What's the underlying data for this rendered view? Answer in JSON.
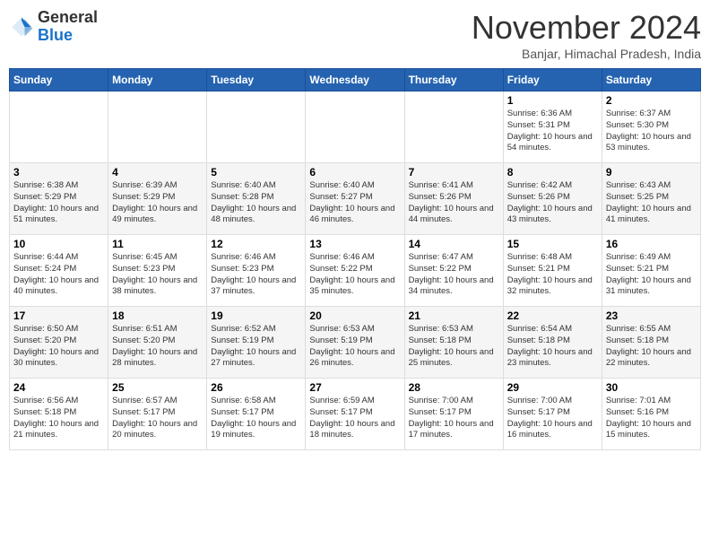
{
  "header": {
    "logo_general": "General",
    "logo_blue": "Blue",
    "month_title": "November 2024",
    "location": "Banjar, Himachal Pradesh, India"
  },
  "days_of_week": [
    "Sunday",
    "Monday",
    "Tuesday",
    "Wednesday",
    "Thursday",
    "Friday",
    "Saturday"
  ],
  "weeks": [
    [
      {
        "day": "",
        "sunrise": "",
        "sunset": "",
        "daylight": ""
      },
      {
        "day": "",
        "sunrise": "",
        "sunset": "",
        "daylight": ""
      },
      {
        "day": "",
        "sunrise": "",
        "sunset": "",
        "daylight": ""
      },
      {
        "day": "",
        "sunrise": "",
        "sunset": "",
        "daylight": ""
      },
      {
        "day": "",
        "sunrise": "",
        "sunset": "",
        "daylight": ""
      },
      {
        "day": "1",
        "sunrise": "Sunrise: 6:36 AM",
        "sunset": "Sunset: 5:31 PM",
        "daylight": "Daylight: 10 hours and 54 minutes."
      },
      {
        "day": "2",
        "sunrise": "Sunrise: 6:37 AM",
        "sunset": "Sunset: 5:30 PM",
        "daylight": "Daylight: 10 hours and 53 minutes."
      }
    ],
    [
      {
        "day": "3",
        "sunrise": "Sunrise: 6:38 AM",
        "sunset": "Sunset: 5:29 PM",
        "daylight": "Daylight: 10 hours and 51 minutes."
      },
      {
        "day": "4",
        "sunrise": "Sunrise: 6:39 AM",
        "sunset": "Sunset: 5:29 PM",
        "daylight": "Daylight: 10 hours and 49 minutes."
      },
      {
        "day": "5",
        "sunrise": "Sunrise: 6:40 AM",
        "sunset": "Sunset: 5:28 PM",
        "daylight": "Daylight: 10 hours and 48 minutes."
      },
      {
        "day": "6",
        "sunrise": "Sunrise: 6:40 AM",
        "sunset": "Sunset: 5:27 PM",
        "daylight": "Daylight: 10 hours and 46 minutes."
      },
      {
        "day": "7",
        "sunrise": "Sunrise: 6:41 AM",
        "sunset": "Sunset: 5:26 PM",
        "daylight": "Daylight: 10 hours and 44 minutes."
      },
      {
        "day": "8",
        "sunrise": "Sunrise: 6:42 AM",
        "sunset": "Sunset: 5:26 PM",
        "daylight": "Daylight: 10 hours and 43 minutes."
      },
      {
        "day": "9",
        "sunrise": "Sunrise: 6:43 AM",
        "sunset": "Sunset: 5:25 PM",
        "daylight": "Daylight: 10 hours and 41 minutes."
      }
    ],
    [
      {
        "day": "10",
        "sunrise": "Sunrise: 6:44 AM",
        "sunset": "Sunset: 5:24 PM",
        "daylight": "Daylight: 10 hours and 40 minutes."
      },
      {
        "day": "11",
        "sunrise": "Sunrise: 6:45 AM",
        "sunset": "Sunset: 5:23 PM",
        "daylight": "Daylight: 10 hours and 38 minutes."
      },
      {
        "day": "12",
        "sunrise": "Sunrise: 6:46 AM",
        "sunset": "Sunset: 5:23 PM",
        "daylight": "Daylight: 10 hours and 37 minutes."
      },
      {
        "day": "13",
        "sunrise": "Sunrise: 6:46 AM",
        "sunset": "Sunset: 5:22 PM",
        "daylight": "Daylight: 10 hours and 35 minutes."
      },
      {
        "day": "14",
        "sunrise": "Sunrise: 6:47 AM",
        "sunset": "Sunset: 5:22 PM",
        "daylight": "Daylight: 10 hours and 34 minutes."
      },
      {
        "day": "15",
        "sunrise": "Sunrise: 6:48 AM",
        "sunset": "Sunset: 5:21 PM",
        "daylight": "Daylight: 10 hours and 32 minutes."
      },
      {
        "day": "16",
        "sunrise": "Sunrise: 6:49 AM",
        "sunset": "Sunset: 5:21 PM",
        "daylight": "Daylight: 10 hours and 31 minutes."
      }
    ],
    [
      {
        "day": "17",
        "sunrise": "Sunrise: 6:50 AM",
        "sunset": "Sunset: 5:20 PM",
        "daylight": "Daylight: 10 hours and 30 minutes."
      },
      {
        "day": "18",
        "sunrise": "Sunrise: 6:51 AM",
        "sunset": "Sunset: 5:20 PM",
        "daylight": "Daylight: 10 hours and 28 minutes."
      },
      {
        "day": "19",
        "sunrise": "Sunrise: 6:52 AM",
        "sunset": "Sunset: 5:19 PM",
        "daylight": "Daylight: 10 hours and 27 minutes."
      },
      {
        "day": "20",
        "sunrise": "Sunrise: 6:53 AM",
        "sunset": "Sunset: 5:19 PM",
        "daylight": "Daylight: 10 hours and 26 minutes."
      },
      {
        "day": "21",
        "sunrise": "Sunrise: 6:53 AM",
        "sunset": "Sunset: 5:18 PM",
        "daylight": "Daylight: 10 hours and 25 minutes."
      },
      {
        "day": "22",
        "sunrise": "Sunrise: 6:54 AM",
        "sunset": "Sunset: 5:18 PM",
        "daylight": "Daylight: 10 hours and 23 minutes."
      },
      {
        "day": "23",
        "sunrise": "Sunrise: 6:55 AM",
        "sunset": "Sunset: 5:18 PM",
        "daylight": "Daylight: 10 hours and 22 minutes."
      }
    ],
    [
      {
        "day": "24",
        "sunrise": "Sunrise: 6:56 AM",
        "sunset": "Sunset: 5:18 PM",
        "daylight": "Daylight: 10 hours and 21 minutes."
      },
      {
        "day": "25",
        "sunrise": "Sunrise: 6:57 AM",
        "sunset": "Sunset: 5:17 PM",
        "daylight": "Daylight: 10 hours and 20 minutes."
      },
      {
        "day": "26",
        "sunrise": "Sunrise: 6:58 AM",
        "sunset": "Sunset: 5:17 PM",
        "daylight": "Daylight: 10 hours and 19 minutes."
      },
      {
        "day": "27",
        "sunrise": "Sunrise: 6:59 AM",
        "sunset": "Sunset: 5:17 PM",
        "daylight": "Daylight: 10 hours and 18 minutes."
      },
      {
        "day": "28",
        "sunrise": "Sunrise: 7:00 AM",
        "sunset": "Sunset: 5:17 PM",
        "daylight": "Daylight: 10 hours and 17 minutes."
      },
      {
        "day": "29",
        "sunrise": "Sunrise: 7:00 AM",
        "sunset": "Sunset: 5:17 PM",
        "daylight": "Daylight: 10 hours and 16 minutes."
      },
      {
        "day": "30",
        "sunrise": "Sunrise: 7:01 AM",
        "sunset": "Sunset: 5:16 PM",
        "daylight": "Daylight: 10 hours and 15 minutes."
      }
    ]
  ]
}
